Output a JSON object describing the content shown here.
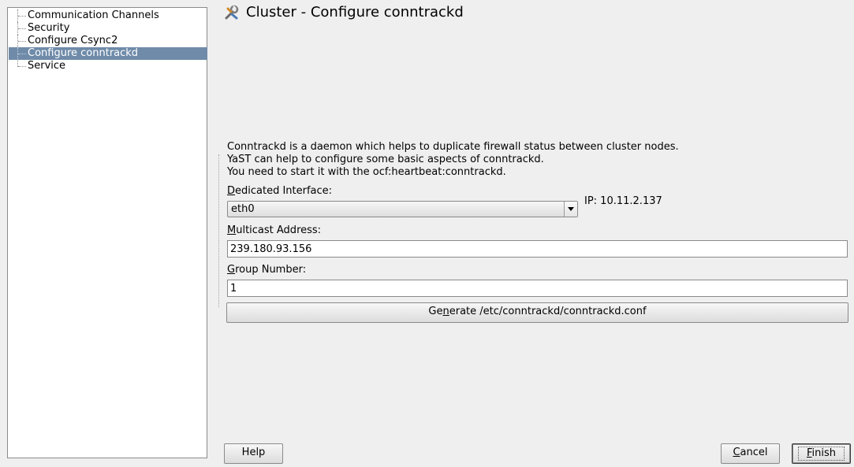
{
  "sidebar": {
    "items": [
      {
        "label": "Communication Channels",
        "selected": false
      },
      {
        "label": "Security",
        "selected": false
      },
      {
        "label": "Configure Csync2",
        "selected": false
      },
      {
        "label": "Configure conntrackd",
        "selected": true
      },
      {
        "label": "Service",
        "selected": false
      }
    ]
  },
  "header": {
    "icon": "wrench-tools-icon",
    "title": "Cluster - Configure conntrackd"
  },
  "main": {
    "description": [
      "Conntrackd is a daemon which helps to duplicate firewall status between cluster nodes.",
      "YaST can help to configure some basic aspects of conntrackd.",
      "You need to start it with the ocf:heartbeat:conntrackd."
    ],
    "dedicated_interface": {
      "label_mnemonic": "D",
      "label_rest": "edicated Interface:",
      "value": "eth0",
      "ip_label": "IP: 10.11.2.137"
    },
    "multicast_address": {
      "label_mnemonic": "M",
      "label_rest": "ulticast Address:",
      "value": "239.180.93.156"
    },
    "group_number": {
      "label_mnemonic": "G",
      "label_rest": "roup Number:",
      "value": "1"
    },
    "generate_button": {
      "label_pre": "Ge",
      "label_mnemonic": "n",
      "label_post": "erate /etc/conntrackd/conntrackd.conf"
    }
  },
  "footer": {
    "help_label": "Help",
    "cancel_mnemonic": "C",
    "cancel_rest": "ancel",
    "finish_mnemonic": "F",
    "finish_rest": "inish"
  },
  "colors": {
    "selection": "#6f8ba9",
    "background": "#efefef"
  }
}
